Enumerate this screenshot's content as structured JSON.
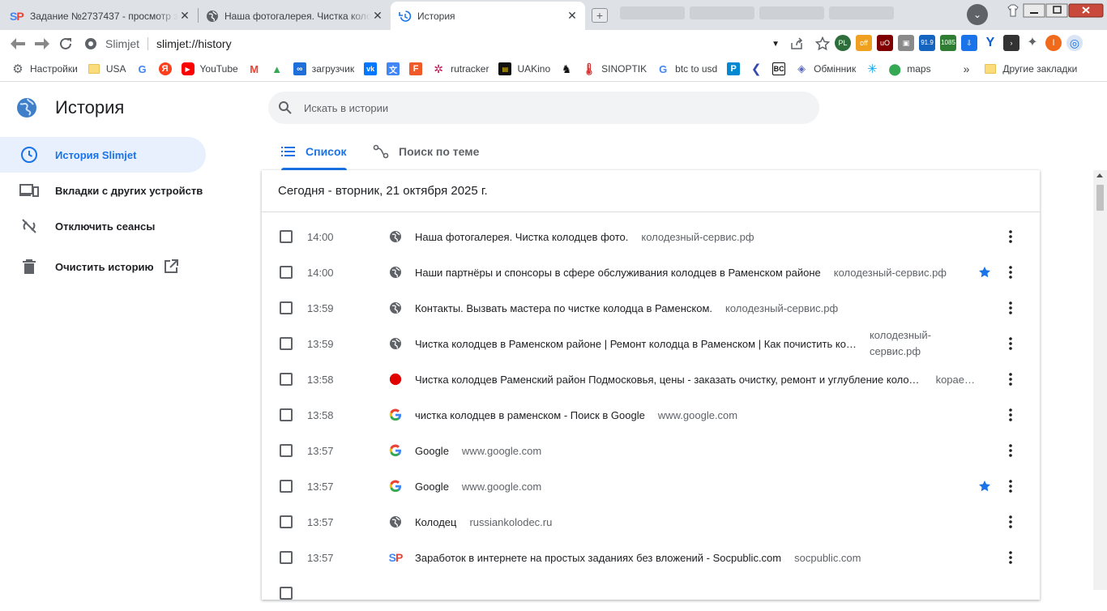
{
  "tabs": [
    {
      "title": "Задание №2737437 - просмотр з",
      "favicon": "socpublic-icon",
      "active": false
    },
    {
      "title": "Наша фотогалерея. Чистка колод",
      "favicon": "globe-icon",
      "active": false
    },
    {
      "title": "История",
      "favicon": "history-icon",
      "active": true
    }
  ],
  "toolbar": {
    "site_name": "Slimjet",
    "url": "slimjet://history",
    "ext_badges": {
      "dl_count": "91.9",
      "temp": "1085"
    },
    "profile_letter": "I"
  },
  "bookmarks": [
    {
      "label": "Настройки",
      "icon": "gear-icon"
    },
    {
      "label": "USA",
      "icon": "folder-icon"
    },
    {
      "label": "",
      "icon": "google-icon"
    },
    {
      "label": "",
      "icon": "yandex-icon"
    },
    {
      "label": "YouTube",
      "icon": "youtube-icon"
    },
    {
      "label": "",
      "icon": "gmail-icon"
    },
    {
      "label": "",
      "icon": "drive-icon"
    },
    {
      "label": "загрузчик",
      "icon": "loader-icon"
    },
    {
      "label": "",
      "icon": "vk-icon"
    },
    {
      "label": "",
      "icon": "translate-icon"
    },
    {
      "label": "",
      "icon": "f-icon"
    },
    {
      "label": "rutracker",
      "icon": "rutracker-icon"
    },
    {
      "label": "UAKino",
      "icon": "uakino-icon"
    },
    {
      "label": "",
      "icon": "horse-icon"
    },
    {
      "label": "SINOPTIK",
      "icon": "thermometer-icon"
    },
    {
      "label": "btc to usd",
      "icon": "google-icon"
    },
    {
      "label": "",
      "icon": "p-icon"
    },
    {
      "label": "",
      "icon": "arrow-icon"
    },
    {
      "label": "",
      "icon": "bc-icon"
    },
    {
      "label": "Обмінник",
      "icon": "exchange-icon"
    },
    {
      "label": "",
      "icon": "snow-icon"
    },
    {
      "label": "maps",
      "icon": "maps-icon"
    }
  ],
  "bookmarks_more": "»",
  "other_bookmarks": "Другие закладки",
  "sidebar": {
    "title": "История",
    "items": [
      {
        "label": "История Slimjet",
        "icon": "clock-icon",
        "selected": true
      },
      {
        "label": "Вкладки с других устройств",
        "icon": "devices-icon",
        "selected": false
      },
      {
        "label": "Отключить сеансы",
        "icon": "sync-off-icon",
        "selected": false
      },
      {
        "label": "Очистить историю",
        "icon": "trash-icon",
        "selected": false
      }
    ]
  },
  "search": {
    "placeholder": "Искать в истории"
  },
  "view_tabs": {
    "list": "Список",
    "topics": "Поиск по теме"
  },
  "history": {
    "date_header": "Сегодня - вторник, 21 октября 2025 г.",
    "rows": [
      {
        "time": "14:00",
        "title": "Наша фотогалерея. Чистка колодцев фото.",
        "domain": "колодезный-сервис.рф",
        "favicon": "globe-icon",
        "starred": false
      },
      {
        "time": "14:00",
        "title": "Наши партнёры и спонсоры в сфере обслуживания колодцев в Раменском районе",
        "domain": "колодезный-сервис.рф",
        "favicon": "globe-icon",
        "starred": true
      },
      {
        "time": "13:59",
        "title": "Контакты. Вызвать мастера по чистке колодца в Раменском.",
        "domain": "колодезный-сервис.рф",
        "favicon": "globe-icon",
        "starred": false
      },
      {
        "time": "13:59",
        "title": "Чистка колодцев в Раменском районе | Ремонт колодца в Раменском | Как почистить ко…",
        "domain": "колодезный-сервис.рф",
        "favicon": "globe-icon",
        "starred": false
      },
      {
        "time": "13:58",
        "title": "Чистка колодцев Раменский район Подмосковья, цены - заказать очистку, ремонт и углубление колодц…",
        "domain": "kopae…",
        "favicon": "red-dot-icon",
        "starred": false
      },
      {
        "time": "13:58",
        "title": "чистка колодцев в раменском - Поиск в Google",
        "domain": "www.google.com",
        "favicon": "google-icon",
        "starred": false
      },
      {
        "time": "13:57",
        "title": "Google",
        "domain": "www.google.com",
        "favicon": "google-icon",
        "starred": false
      },
      {
        "time": "13:57",
        "title": "Google",
        "domain": "www.google.com",
        "favicon": "google-icon",
        "starred": true
      },
      {
        "time": "13:57",
        "title": "Колодец",
        "domain": "russiankolodec.ru",
        "favicon": "globe-icon",
        "starred": false
      },
      {
        "time": "13:57",
        "title": "Заработок в интернете на простых заданиях без вложений - Socpublic.com",
        "domain": "socpublic.com",
        "favicon": "socpublic-icon",
        "starred": false
      }
    ]
  },
  "colors": {
    "accent": "#1a73e8",
    "selected_bg": "#e8f0fe",
    "star": "#1a73e8",
    "tabstrip": "#dee1e6"
  }
}
